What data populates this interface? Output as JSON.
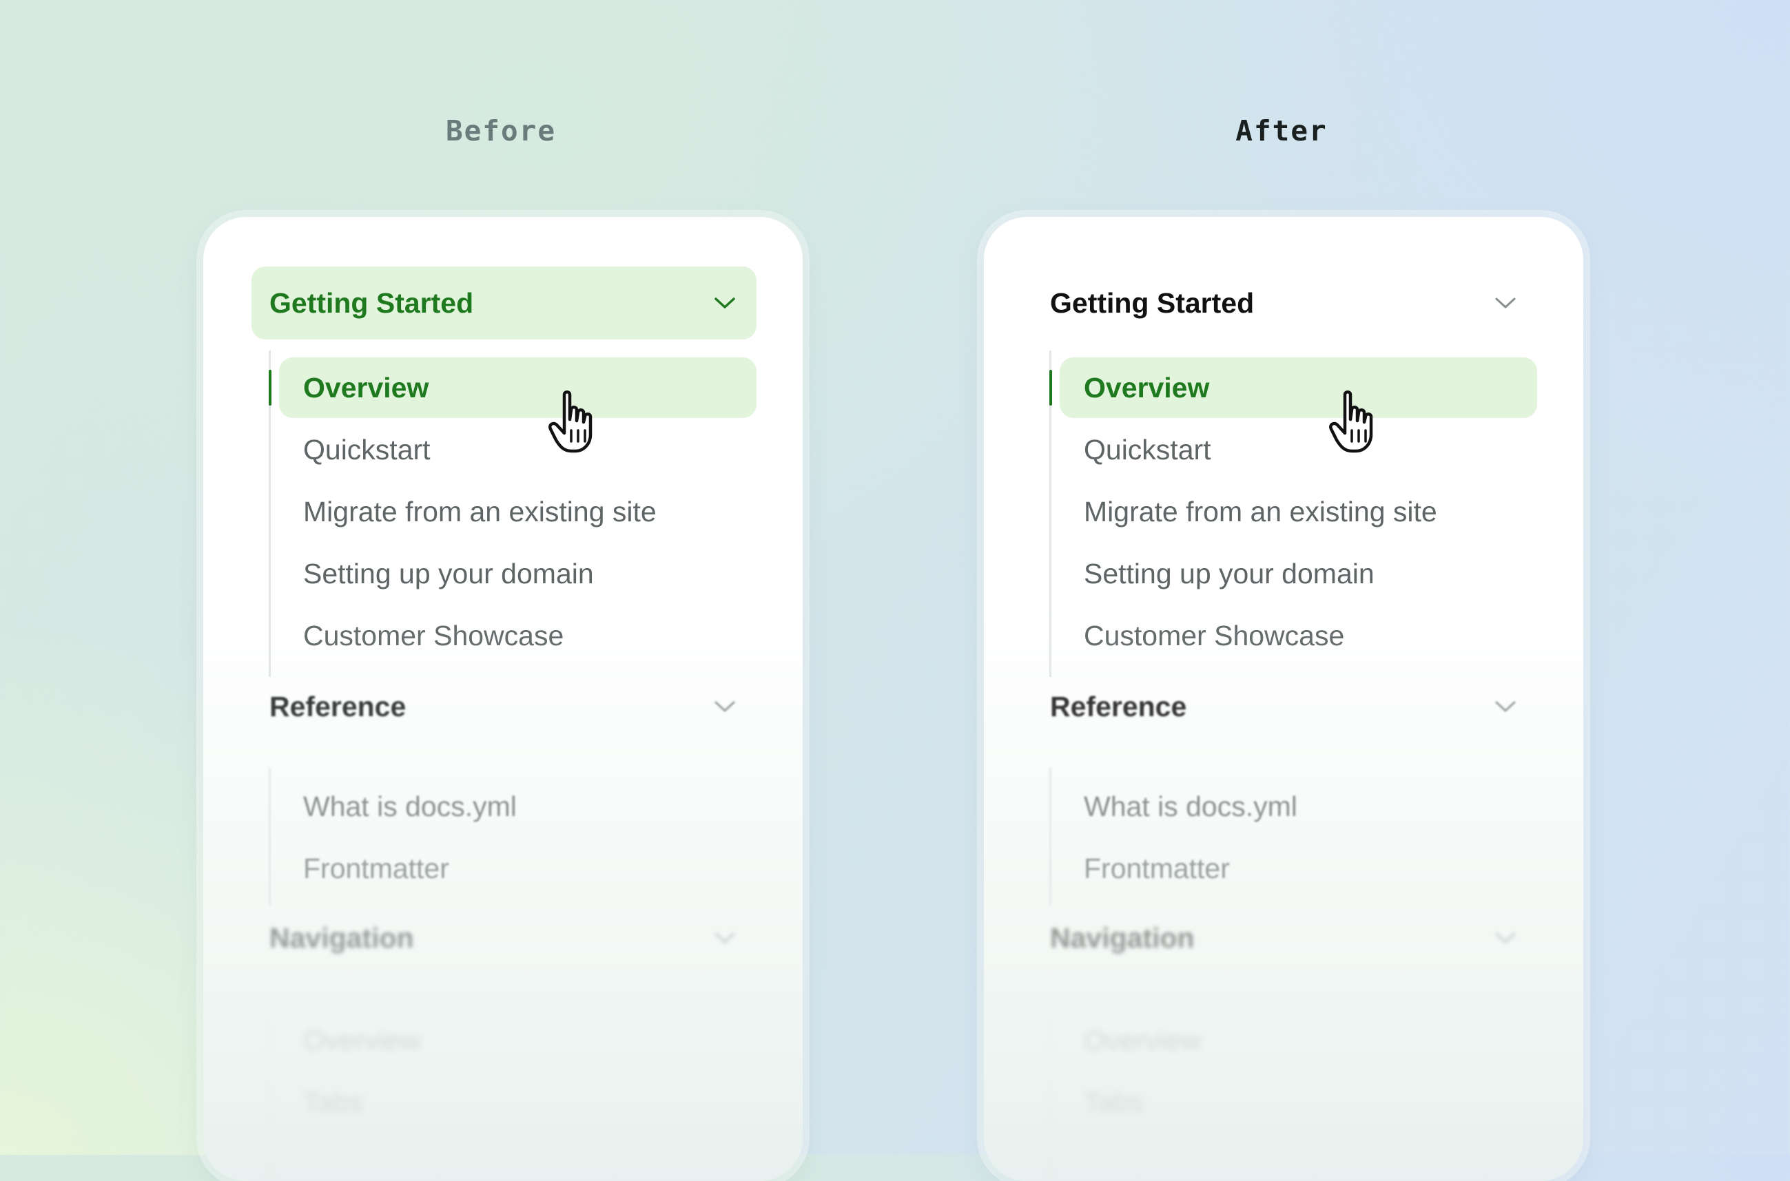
{
  "labels": {
    "before": "Before",
    "after": "After"
  },
  "sidebar": {
    "groups": [
      {
        "title": "Getting Started",
        "items": [
          "Overview",
          "Quickstart",
          "Migrate from an existing site",
          "Setting up your domain",
          "Customer Showcase"
        ]
      },
      {
        "title": "Reference",
        "items": [
          "What is docs.yml",
          "Frontmatter"
        ]
      },
      {
        "title": "Navigation",
        "items": [
          "Overview",
          "Tabs"
        ]
      }
    ],
    "active_item": "Overview"
  },
  "colors": {
    "active_green": "#1f7a1f",
    "active_bg": "#e2f4dc",
    "text_muted": "#5f6566"
  },
  "icons": {
    "chevron": "chevron-down-icon",
    "cursor": "hand-pointer-icon"
  }
}
